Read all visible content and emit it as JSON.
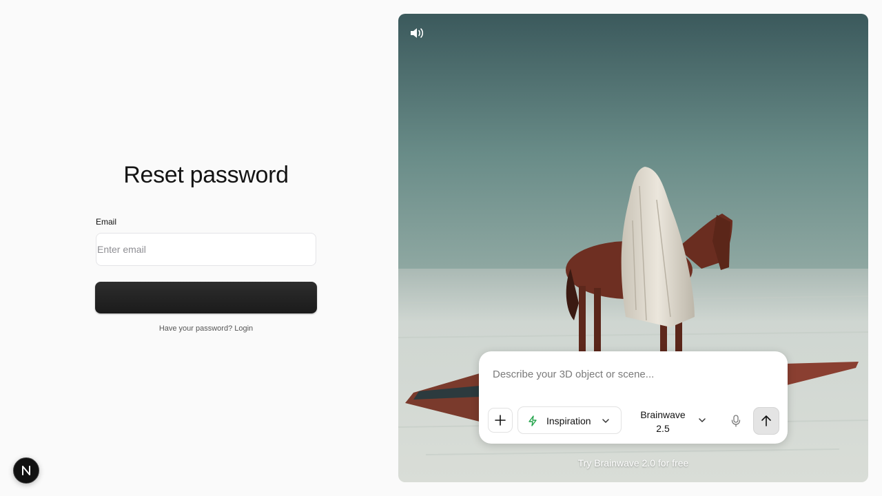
{
  "reset_form": {
    "title": "Reset password",
    "email_label": "Email",
    "email_placeholder": "Enter email",
    "email_value": "",
    "submit_label": "",
    "login_prompt": "Have your password? Login"
  },
  "badge": {
    "letter": "N"
  },
  "media": {
    "sound_icon": "speaker-volume-icon",
    "prompt": {
      "placeholder": "Describe your 3D object or scene...",
      "value": "",
      "add_icon": "plus-icon",
      "mode_icon": "lightning-bolt-icon",
      "mode_label": "Inspiration",
      "model_label": "Brainwave 2.5",
      "mic_icon": "microphone-icon",
      "send_icon": "arrow-up-icon"
    },
    "promo": "Try Brainwave 2.0 for free"
  },
  "colors": {
    "page_background": "#fafafa",
    "button_dark": "#1f1f1f",
    "bolt_green": "#22a34a",
    "sky_top": "#3b5a5c",
    "salt_flat": "#d8dcd6"
  }
}
